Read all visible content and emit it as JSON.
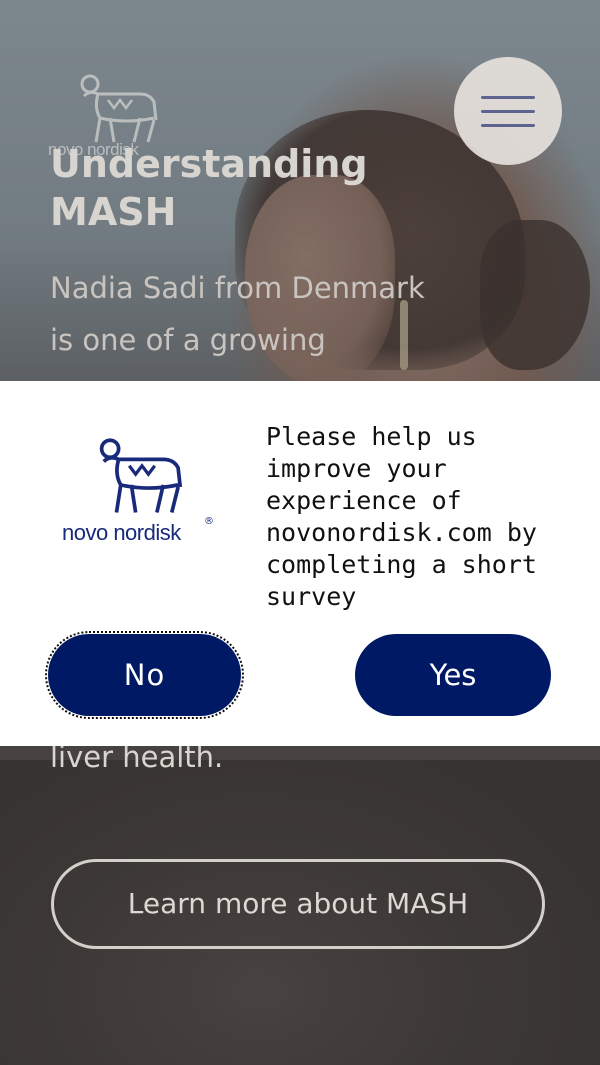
{
  "hero": {
    "title": "Understanding MASH",
    "description": "Nadia Sadi from Denmark is one of a growing",
    "description_tail": "liver health.",
    "cta_label": "Learn more about MASH"
  },
  "header": {
    "logo_text": "novo nordisk",
    "menu_icon": "hamburger-menu-icon"
  },
  "survey": {
    "logo_text": "novo nordisk",
    "logo_mark": "®",
    "message": "Please help us improve your experience of novonordisk.com by completing a short survey",
    "no_label": "No",
    "yes_label": "Yes"
  },
  "colors": {
    "brand_blue": "#001965",
    "logo_blue": "#1a2a7a",
    "menu_line": "#5c6391"
  }
}
